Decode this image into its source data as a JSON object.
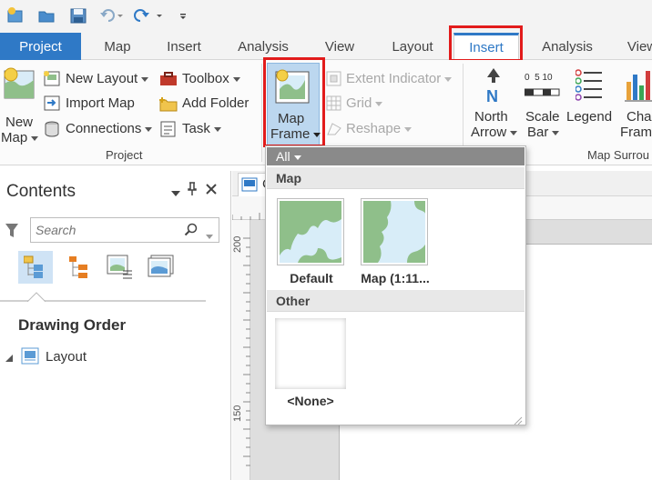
{
  "quick_access": {
    "icons": [
      "new-project-icon",
      "open-icon",
      "save-icon",
      "undo-icon",
      "redo-icon",
      "customize-icon"
    ]
  },
  "tabs": [
    {
      "label": "Project"
    },
    {
      "label": "Map"
    },
    {
      "label": "Insert"
    },
    {
      "label": "Analysis"
    },
    {
      "label": "View"
    },
    {
      "label": "Layout"
    },
    {
      "label": "Insert"
    },
    {
      "label": "Analysis"
    },
    {
      "label": "View"
    }
  ],
  "ribbon": {
    "new_map": {
      "line1": "New",
      "line2": "Map"
    },
    "new_layout": "New Layout",
    "import_map": "Import Map",
    "connections": "Connections",
    "toolbox": "Toolbox",
    "add_folder": "Add Folder",
    "task": "Task",
    "project_group": "Project",
    "map_frame": {
      "line1": "Map",
      "line2": "Frame"
    },
    "extent_indicator": "Extent Indicator",
    "grid": "Grid",
    "reshape": "Reshape",
    "north_arrow": {
      "line1": "North",
      "line2": "Arrow"
    },
    "scale_bar": {
      "line1": "Scale",
      "line2": "Bar",
      "ticks": "0  5 10"
    },
    "legend": "Legend",
    "chart_frame": {
      "line1": "Char",
      "line2": "Frame"
    },
    "map_surround_group": "Map Surrou"
  },
  "gallery": {
    "filter": "All",
    "section_map": "Map",
    "items_map": [
      {
        "label": "Default"
      },
      {
        "label": "Map (1:11..."
      }
    ],
    "section_other": "Other",
    "items_other": [
      {
        "label": "<None>"
      }
    ]
  },
  "contents": {
    "title": "Contents",
    "search_placeholder": "Search",
    "drawing_order": "Drawing Order",
    "layers": [
      {
        "label": "Layout"
      }
    ]
  },
  "view": {
    "tab_partial": "C",
    "ruler_labels": [
      "200",
      "150"
    ]
  },
  "colors": {
    "accent": "#2f79c6",
    "highlight": "#e21b1b",
    "map_land": "#8fbf8a",
    "map_water": "#d8edf8"
  }
}
